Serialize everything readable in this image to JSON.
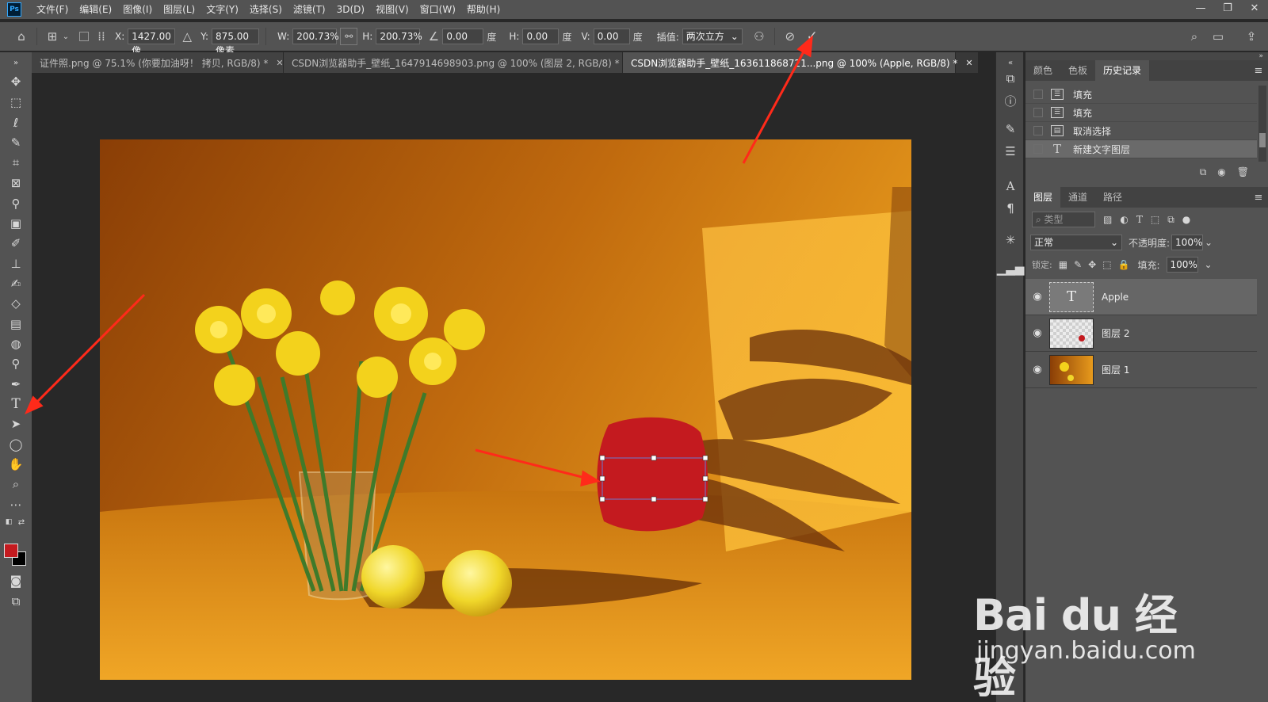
{
  "app": {
    "logo_text": "Ps"
  },
  "menu": [
    "文件(F)",
    "编辑(E)",
    "图像(I)",
    "图层(L)",
    "文字(Y)",
    "选择(S)",
    "滤镜(T)",
    "3D(D)",
    "视图(V)",
    "窗口(W)",
    "帮助(H)"
  ],
  "options": {
    "x_label": "X:",
    "x_value": "1427.00 像",
    "y_label": "Y:",
    "y_value": "875.00 像素",
    "w_label": "W:",
    "w_value": "200.73%",
    "h_label": "H:",
    "h_value": "200.73%",
    "angle_value": "0.00",
    "angle_unit": "度",
    "hskew_label": "H:",
    "hskew_value": "0.00",
    "hskew_unit": "度",
    "vskew_label": "V:",
    "vskew_value": "0.00",
    "vskew_unit": "度",
    "interp_label": "插值:",
    "interp_value": "两次立方"
  },
  "tabs": [
    {
      "label": "证件照.png @ 75.1% (你要加油呀！ 拷贝, RGB/8) *"
    },
    {
      "label": "CSDN浏览器助手_壁纸_1647914698903.png @ 100% (图层 2, RGB/8) *"
    },
    {
      "label": "CSDN浏览器助手_壁纸_163611868721...png @ 100% (Apple, RGB/8) *"
    }
  ],
  "history_panel": {
    "tabs": [
      "颜色",
      "色板",
      "历史记录"
    ],
    "items": [
      {
        "label": "填充"
      },
      {
        "label": "填充"
      },
      {
        "label": "取消选择"
      },
      {
        "label": "新建文字图层"
      }
    ]
  },
  "layers_panel": {
    "tabs": [
      "图层",
      "通道",
      "路径"
    ],
    "filter_placeholder": "类型",
    "blend_mode": "正常",
    "opacity_label": "不透明度:",
    "opacity_value": "100%",
    "lock_label": "锁定:",
    "fill_label": "填充:",
    "fill_value": "100%",
    "layers": [
      {
        "name": "Apple",
        "type": "text"
      },
      {
        "name": "图层 2",
        "type": "pixel-red-dot"
      },
      {
        "name": "图层 1",
        "type": "photo"
      }
    ]
  },
  "watermark": {
    "brand": "Bai du 经验",
    "url": "jingyan.baidu.com"
  },
  "colors": {
    "foreground": "#c41a1f",
    "background": "#000000",
    "accent_arrow": "#ff2a1a"
  }
}
